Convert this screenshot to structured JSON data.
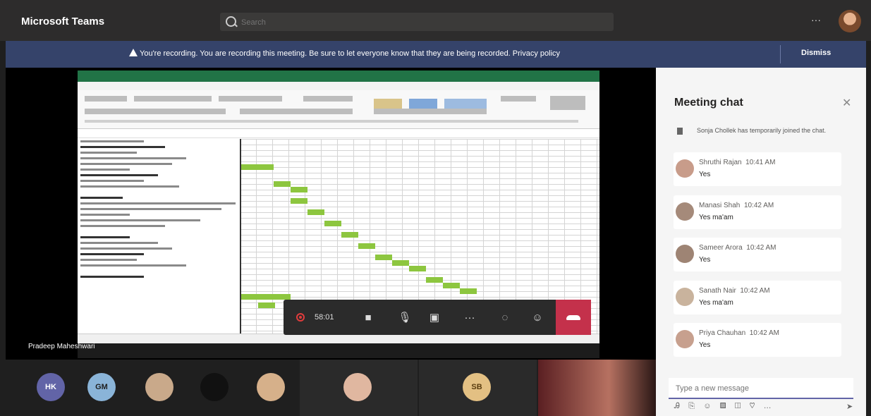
{
  "app": {
    "title": "Microsoft Teams",
    "search_placeholder": "Search",
    "more": "···"
  },
  "banner": {
    "message": "You're recording. You are recording this meeting. Be sure to let everyone know that they are being recorded. Privacy policy",
    "dismiss_label": "Dismiss"
  },
  "stage": {
    "presenter_name": "Pradeep Maheshwari"
  },
  "controls": {
    "timer": "58:01",
    "more": "···"
  },
  "participants": [
    {
      "initials": "HK",
      "color": "#6264a7"
    },
    {
      "initials": "GM",
      "color": "#8ab4d8"
    },
    {
      "initials": "",
      "color": "#c9a98a"
    },
    {
      "initials": "",
      "color": "#111111"
    },
    {
      "initials": "",
      "color": "#d6b08a"
    },
    {
      "initials": "",
      "color": "#e0b7a0"
    },
    {
      "initials": "SB",
      "color": "#e3c083"
    }
  ],
  "chat": {
    "title": "Meeting chat",
    "system_message": "Sonja Chollek has temporarily joined the chat.",
    "messages": [
      {
        "author": "Shruthi Rajan",
        "time": "10:41 AM",
        "text": "Yes",
        "avatar_color": "#c89c8a"
      },
      {
        "author": "Manasi Shah",
        "time": "10:42 AM",
        "text": "Yes ma'am",
        "avatar_color": "#a58a7a"
      },
      {
        "author": "Sameer Arora",
        "time": "10:42 AM",
        "text": "Yes",
        "avatar_color": "#9e8474"
      },
      {
        "author": "Sanath Nair",
        "time": "10:42 AM",
        "text": "Yes ma'am",
        "avatar_color": "#c9b39d"
      },
      {
        "author": "Priya Chauhan",
        "time": "10:42 AM",
        "text": "Yes",
        "avatar_color": "#c7a08e"
      }
    ],
    "compose_placeholder": "Type a new message"
  }
}
